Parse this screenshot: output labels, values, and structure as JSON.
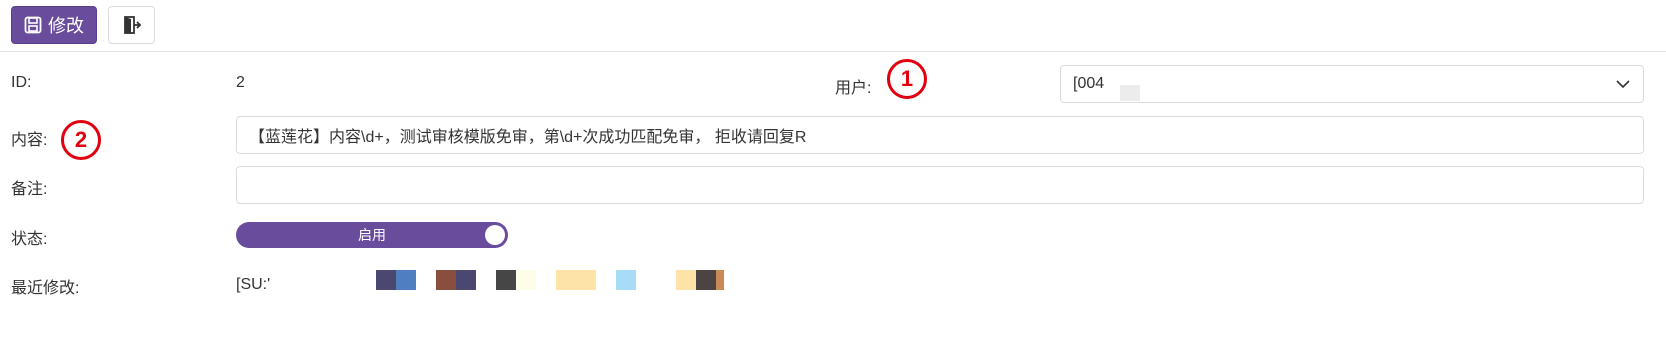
{
  "toolbar": {
    "save_label": "修改",
    "save_icon": "floppy-disk-icon",
    "exit_icon": "door-exit-icon"
  },
  "form": {
    "id_label": "ID:",
    "id_value": "2",
    "user_label": "用户:",
    "user_value": "[004",
    "content_label": "内容:",
    "content_value": "【蓝莲花】内容\\d+，测试审核模版免审，第\\d+次成功匹配免审， 拒收请回复R",
    "remark_label": "备注:",
    "remark_value": "",
    "status_label": "状态:",
    "status_value": "启用",
    "modified_label": "最近修改:",
    "modified_value": "[SU:'"
  },
  "markers": [
    "1",
    "2"
  ],
  "colors": {
    "accent": "#6a4c9c",
    "marker": "#e0000f",
    "swatches": [
      "#4a4770",
      "#4f7fc1",
      "#8a4e3e",
      "#4a4770",
      "#464646",
      "#fdfde8",
      "#fde3a8",
      "#fde3a8",
      "#a6dcf5",
      "#fde3a8",
      "#4c4444",
      "#c98a58"
    ]
  }
}
